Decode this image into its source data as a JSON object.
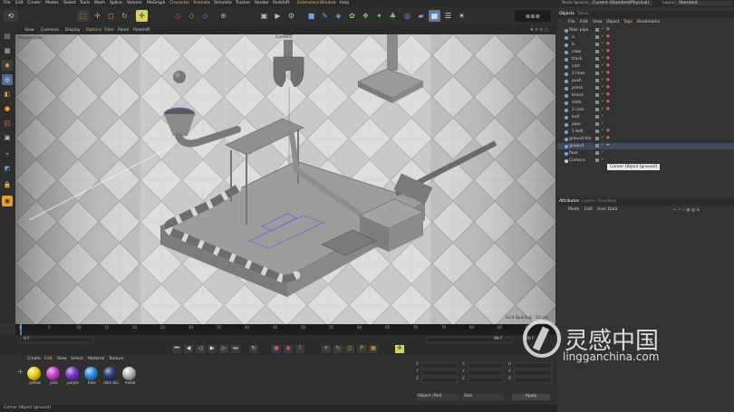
{
  "menu": {
    "items": [
      "File",
      "Edit",
      "Create",
      "Modes",
      "Select",
      "Tools",
      "Mesh",
      "Spline",
      "Volume",
      "MoGraph",
      "Character",
      "Animate",
      "Simulate",
      "Tracker",
      "Render",
      "Redshift",
      "Extensions",
      "Window",
      "Help"
    ],
    "node_space_label": "Node Spaces:",
    "node_space_value": "Current (Standard/Physical)",
    "layout_label": "Layout:",
    "layout_value": "Standard"
  },
  "viewport": {
    "menu": [
      "View",
      "Cameras",
      "Display",
      "Options",
      "Filter",
      "Panel",
      "Redshift"
    ],
    "label": "Perspective",
    "camera_label": "Camera",
    "grid_spacing": "Grid Spacing : 50 cm"
  },
  "timeline": {
    "ticks": [
      "0",
      "5",
      "10",
      "15",
      "20",
      "25",
      "30",
      "35",
      "40",
      "45",
      "50",
      "55",
      "60",
      "65",
      "70",
      "75",
      "80",
      "85",
      "90"
    ],
    "start": "0 F",
    "end": "90 F",
    "end2": "90 F"
  },
  "materials": {
    "menu": [
      "Create",
      "Edit",
      "View",
      "Select",
      "Material",
      "Texture"
    ],
    "items": [
      {
        "name": "yellow",
        "color": "#e9d21e"
      },
      {
        "name": "pink",
        "color": "#c247c9"
      },
      {
        "name": "purple",
        "color": "#7a3fcf"
      },
      {
        "name": "blue",
        "color": "#2f8ee0"
      },
      {
        "name": "dark blu",
        "color": "#2a3e6e"
      },
      {
        "name": "metal",
        "color": "#b8b8b8"
      }
    ]
  },
  "coords": {
    "labels": [
      "X",
      "Y",
      "Z",
      "X",
      "Y",
      "Z",
      "H",
      "P",
      "B"
    ],
    "mode": "Object (Rel)",
    "mode2": "Size",
    "apply": "Apply"
  },
  "status": "Corner Object [ground]",
  "objects": {
    "tabs": [
      "Objects",
      "Takes"
    ],
    "menu": [
      "File",
      "Edit",
      "View",
      "Object",
      "Tags",
      "Bookmarks"
    ],
    "rows": [
      "floor pipe",
      "a",
      "b",
      "claw",
      "track",
      "cart",
      "2 lines",
      "push",
      "press",
      "brace",
      "slide",
      "2 coin",
      "bell",
      "pipe",
      "1 bell",
      "ground tile",
      "ground",
      "floor",
      "Camera"
    ],
    "tooltip": "Corner Object [ground]"
  },
  "attributes": {
    "tabs": [
      "Attributes",
      "Layers",
      "Structure"
    ],
    "menu": [
      "Mode",
      "Edit",
      "User Data"
    ]
  },
  "watermark": {
    "title": "灵感中国",
    "url": "lingganchina.com"
  }
}
